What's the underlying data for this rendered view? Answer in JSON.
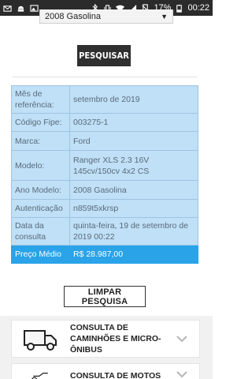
{
  "status_bar": {
    "battery": "17%",
    "time": "00:22"
  },
  "select": {
    "value": "2008 Gasolina"
  },
  "search_button": "PESQUISAR",
  "results": [
    {
      "label": "Mês de referência:",
      "value": "setembro de 2019"
    },
    {
      "label": "Código Fipe:",
      "value": "003275-1"
    },
    {
      "label": "Marca:",
      "value": "Ford"
    },
    {
      "label": "Modelo:",
      "value": "Ranger XLS 2.3 16V 145cv/150cv 4x2 CS"
    },
    {
      "label": "Ano Modelo:",
      "value": "2008 Gasolina"
    },
    {
      "label": "Autenticação",
      "value": "n859t5xkrsp"
    },
    {
      "label": "Data da consulta",
      "value": "quinta-feira, 19 de setembro de 2019 00:22"
    },
    {
      "label": "Preço Médio",
      "value": "R$ 28.987,00"
    }
  ],
  "clear_button": "LIMPAR PESQUISA",
  "cards": [
    {
      "label": "CONSULTA DE CAMINHÕES E MICRO-ÔNIBUS"
    },
    {
      "label": "CONSULTA DE MOTOS"
    }
  ]
}
